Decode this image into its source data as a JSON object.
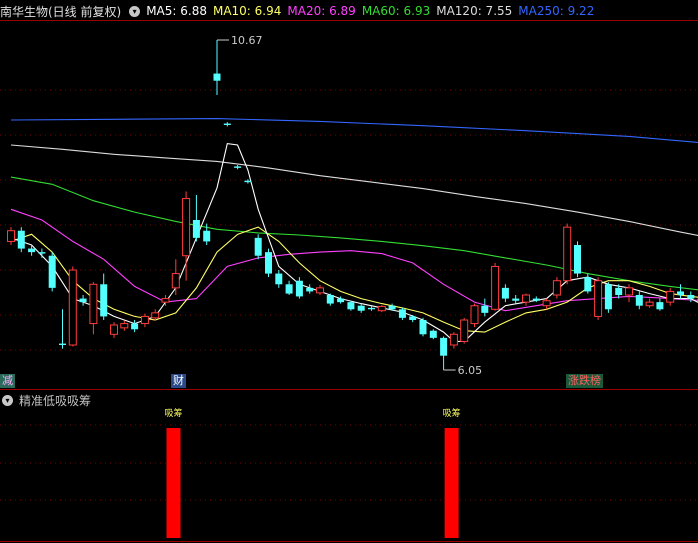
{
  "header": {
    "stock_title": "南华生物(日线 前复权)",
    "ma5": "MA5: 6.88",
    "ma10": "MA10: 6.94",
    "ma20": "MA20: 6.89",
    "ma60": "MA60: 6.93",
    "ma120": "MA120: 7.55",
    "ma250": "MA250: 9.22"
  },
  "subpanel": {
    "title": "精准低吸吸筹",
    "signal_label": "吸筹"
  },
  "markers": {
    "left": "减",
    "middle": "财",
    "right": "涨跌榜"
  },
  "colors": {
    "up": "#ff3c3c",
    "down": "#54ffff",
    "ma5": "#ffffff",
    "ma10": "#ffff66",
    "ma20": "#ff40ff",
    "ma60": "#33dd33",
    "ma120": "#dcdcdc",
    "ma250": "#3366ff",
    "grid": "#7a0000",
    "signal_bar": "#ff0000"
  },
  "chart_data": {
    "type": "candlestick",
    "annotations": {
      "high_label": "10.67",
      "low_label": "6.05"
    },
    "candles": [
      {
        "o": 7.85,
        "c": 8.0,
        "h": 8.05,
        "l": 7.8,
        "up": true
      },
      {
        "o": 8.0,
        "c": 7.75,
        "h": 8.05,
        "l": 7.7,
        "up": false
      },
      {
        "o": 7.75,
        "c": 7.7,
        "h": 7.8,
        "l": 7.65,
        "up": false
      },
      {
        "o": 7.7,
        "c": 7.68,
        "h": 7.75,
        "l": 7.62,
        "up": false
      },
      {
        "o": 7.65,
        "c": 7.2,
        "h": 7.7,
        "l": 7.15,
        "up": false
      },
      {
        "o": 6.42,
        "c": 6.4,
        "h": 6.9,
        "l": 6.35,
        "up": false
      },
      {
        "o": 6.4,
        "c": 7.45,
        "h": 7.5,
        "l": 6.38,
        "up": true
      },
      {
        "o": 7.0,
        "c": 7.05,
        "h": 7.1,
        "l": 6.95,
        "up": false
      },
      {
        "o": 6.7,
        "c": 7.25,
        "h": 7.28,
        "l": 6.55,
        "up": true
      },
      {
        "o": 7.25,
        "c": 6.8,
        "h": 7.4,
        "l": 6.75,
        "up": false
      },
      {
        "o": 6.55,
        "c": 6.68,
        "h": 6.72,
        "l": 6.5,
        "up": true
      },
      {
        "o": 6.64,
        "c": 6.7,
        "h": 6.74,
        "l": 6.6,
        "up": true
      },
      {
        "o": 6.7,
        "c": 6.62,
        "h": 6.75,
        "l": 6.58,
        "up": false
      },
      {
        "o": 6.7,
        "c": 6.8,
        "h": 6.84,
        "l": 6.65,
        "up": true
      },
      {
        "o": 6.78,
        "c": 6.85,
        "h": 6.9,
        "l": 6.74,
        "up": true
      },
      {
        "o": 7.0,
        "c": 7.05,
        "h": 7.1,
        "l": 6.95,
        "up": true
      },
      {
        "o": 7.2,
        "c": 7.4,
        "h": 7.6,
        "l": 7.1,
        "up": true
      },
      {
        "o": 7.65,
        "c": 8.45,
        "h": 8.55,
        "l": 7.3,
        "up": true
      },
      {
        "o": 8.15,
        "c": 7.9,
        "h": 8.5,
        "l": 7.85,
        "up": false
      },
      {
        "o": 8.0,
        "c": 7.85,
        "h": 8.1,
        "l": 7.8,
        "up": false
      },
      {
        "o": 10.1,
        "c": 10.2,
        "h": 10.67,
        "l": 9.9,
        "up": false
      },
      {
        "o": 9.5,
        "c": 9.48,
        "h": 9.52,
        "l": 9.46,
        "up": false
      },
      {
        "o": 8.9,
        "c": 8.88,
        "h": 8.92,
        "l": 8.86,
        "up": false
      },
      {
        "o": 8.7,
        "c": 8.68,
        "h": 8.72,
        "l": 8.66,
        "up": false
      },
      {
        "o": 7.9,
        "c": 7.65,
        "h": 7.95,
        "l": 7.6,
        "up": false
      },
      {
        "o": 7.7,
        "c": 7.4,
        "h": 7.75,
        "l": 7.35,
        "up": false
      },
      {
        "o": 7.4,
        "c": 7.25,
        "h": 7.45,
        "l": 7.2,
        "up": false
      },
      {
        "o": 7.25,
        "c": 7.12,
        "h": 7.3,
        "l": 7.1,
        "up": false
      },
      {
        "o": 7.3,
        "c": 7.08,
        "h": 7.35,
        "l": 7.05,
        "up": false
      },
      {
        "o": 7.2,
        "c": 7.15,
        "h": 7.25,
        "l": 7.12,
        "up": false
      },
      {
        "o": 7.13,
        "c": 7.2,
        "h": 7.24,
        "l": 7.1,
        "up": true
      },
      {
        "o": 7.1,
        "c": 6.98,
        "h": 7.12,
        "l": 6.95,
        "up": false
      },
      {
        "o": 7.05,
        "c": 7.0,
        "h": 7.08,
        "l": 6.98,
        "up": false
      },
      {
        "o": 7.0,
        "c": 6.9,
        "h": 7.02,
        "l": 6.88,
        "up": false
      },
      {
        "o": 6.95,
        "c": 6.88,
        "h": 6.98,
        "l": 6.85,
        "up": false
      },
      {
        "o": 6.92,
        "c": 6.9,
        "h": 6.94,
        "l": 6.88,
        "up": false
      },
      {
        "o": 6.88,
        "c": 6.94,
        "h": 6.96,
        "l": 6.86,
        "up": true
      },
      {
        "o": 6.95,
        "c": 6.9,
        "h": 6.98,
        "l": 6.88,
        "up": false
      },
      {
        "o": 6.9,
        "c": 6.78,
        "h": 6.92,
        "l": 6.75,
        "up": false
      },
      {
        "o": 6.8,
        "c": 6.75,
        "h": 6.82,
        "l": 6.72,
        "up": false
      },
      {
        "o": 6.75,
        "c": 6.55,
        "h": 6.78,
        "l": 6.52,
        "up": false
      },
      {
        "o": 6.6,
        "c": 6.5,
        "h": 6.62,
        "l": 6.48,
        "up": false
      },
      {
        "o": 6.5,
        "c": 6.25,
        "h": 6.52,
        "l": 6.05,
        "up": false
      },
      {
        "o": 6.4,
        "c": 6.55,
        "h": 6.58,
        "l": 6.35,
        "up": true
      },
      {
        "o": 6.45,
        "c": 6.75,
        "h": 6.78,
        "l": 6.42,
        "up": true
      },
      {
        "o": 6.7,
        "c": 6.95,
        "h": 6.98,
        "l": 6.65,
        "up": true
      },
      {
        "o": 6.95,
        "c": 6.85,
        "h": 7.05,
        "l": 6.8,
        "up": false
      },
      {
        "o": 6.9,
        "c": 7.5,
        "h": 7.55,
        "l": 6.88,
        "up": true
      },
      {
        "o": 7.2,
        "c": 7.05,
        "h": 7.25,
        "l": 7.0,
        "up": false
      },
      {
        "o": 7.05,
        "c": 7.02,
        "h": 7.1,
        "l": 6.98,
        "up": false
      },
      {
        "o": 7.0,
        "c": 7.1,
        "h": 7.12,
        "l": 6.95,
        "up": true
      },
      {
        "o": 7.05,
        "c": 7.02,
        "h": 7.08,
        "l": 7.0,
        "up": false
      },
      {
        "o": 6.95,
        "c": 7.02,
        "h": 7.05,
        "l": 6.9,
        "up": true
      },
      {
        "o": 7.1,
        "c": 7.3,
        "h": 7.35,
        "l": 7.05,
        "up": true
      },
      {
        "o": 7.3,
        "c": 8.05,
        "h": 8.1,
        "l": 7.25,
        "up": true
      },
      {
        "o": 7.8,
        "c": 7.4,
        "h": 7.85,
        "l": 7.35,
        "up": false
      },
      {
        "o": 7.35,
        "c": 7.15,
        "h": 7.4,
        "l": 7.12,
        "up": false
      },
      {
        "o": 6.8,
        "c": 7.3,
        "h": 7.35,
        "l": 6.75,
        "up": true
      },
      {
        "o": 7.25,
        "c": 6.9,
        "h": 7.28,
        "l": 6.85,
        "up": false
      },
      {
        "o": 7.2,
        "c": 7.1,
        "h": 7.25,
        "l": 7.05,
        "up": false
      },
      {
        "o": 7.1,
        "c": 7.2,
        "h": 7.25,
        "l": 7.0,
        "up": true
      },
      {
        "o": 7.1,
        "c": 6.95,
        "h": 7.15,
        "l": 6.9,
        "up": false
      },
      {
        "o": 6.95,
        "c": 7.0,
        "h": 7.05,
        "l": 6.92,
        "up": true
      },
      {
        "o": 7.0,
        "c": 6.9,
        "h": 7.05,
        "l": 6.88,
        "up": false
      },
      {
        "o": 7.0,
        "c": 7.15,
        "h": 7.2,
        "l": 6.95,
        "up": true
      },
      {
        "o": 7.15,
        "c": 7.1,
        "h": 7.25,
        "l": 7.05,
        "up": false
      },
      {
        "o": 7.1,
        "c": 7.05,
        "h": 7.15,
        "l": 7.0,
        "up": false
      },
      {
        "o": 7.05,
        "c": 7.0,
        "h": 7.1,
        "l": 6.95,
        "up": false
      },
      {
        "o": 7.0,
        "c": 6.95,
        "h": 7.05,
        "l": 6.6,
        "up": false
      }
    ],
    "ma_lines": [
      {
        "name": "MA250",
        "key": "ma250",
        "points": [
          [
            0,
            9.55
          ],
          [
            10,
            9.56
          ],
          [
            20,
            9.57
          ],
          [
            30,
            9.53
          ],
          [
            40,
            9.47
          ],
          [
            50,
            9.4
          ],
          [
            60,
            9.32
          ],
          [
            68,
            9.22
          ]
        ]
      },
      {
        "name": "MA120",
        "key": "ma120",
        "points": [
          [
            0,
            9.2
          ],
          [
            5,
            9.14
          ],
          [
            10,
            9.07
          ],
          [
            15,
            9.02
          ],
          [
            20,
            8.97
          ],
          [
            25,
            8.88
          ],
          [
            30,
            8.77
          ],
          [
            35,
            8.68
          ],
          [
            40,
            8.59
          ],
          [
            45,
            8.48
          ],
          [
            50,
            8.38
          ],
          [
            55,
            8.26
          ],
          [
            60,
            8.13
          ],
          [
            65,
            7.98
          ],
          [
            68,
            7.9
          ]
        ]
      },
      {
        "name": "MA60",
        "key": "ma60",
        "points": [
          [
            0,
            8.75
          ],
          [
            4,
            8.65
          ],
          [
            8,
            8.42
          ],
          [
            12,
            8.26
          ],
          [
            16,
            8.13
          ],
          [
            20,
            8.02
          ],
          [
            24,
            7.97
          ],
          [
            28,
            7.94
          ],
          [
            32,
            7.9
          ],
          [
            36,
            7.85
          ],
          [
            40,
            7.79
          ],
          [
            44,
            7.72
          ],
          [
            48,
            7.62
          ],
          [
            52,
            7.52
          ],
          [
            56,
            7.4
          ],
          [
            60,
            7.3
          ],
          [
            64,
            7.22
          ],
          [
            68,
            7.15
          ]
        ]
      },
      {
        "name": "MA20",
        "key": "ma20",
        "points": [
          [
            0,
            8.3
          ],
          [
            3,
            8.15
          ],
          [
            6,
            7.85
          ],
          [
            9,
            7.6
          ],
          [
            12,
            7.22
          ],
          [
            15,
            7.0
          ],
          [
            18,
            7.05
          ],
          [
            21,
            7.5
          ],
          [
            24,
            7.62
          ],
          [
            27,
            7.67
          ],
          [
            30,
            7.7
          ],
          [
            33,
            7.72
          ],
          [
            36,
            7.68
          ],
          [
            39,
            7.55
          ],
          [
            42,
            7.25
          ],
          [
            45,
            7.0
          ],
          [
            48,
            6.88
          ],
          [
            51,
            6.95
          ],
          [
            54,
            7.02
          ],
          [
            57,
            7.05
          ],
          [
            60,
            7.08
          ],
          [
            63,
            7.06
          ],
          [
            66,
            7.03
          ],
          [
            68,
            7.02
          ]
        ]
      },
      {
        "name": "MA10",
        "key": "ma10",
        "points": [
          [
            0,
            7.85
          ],
          [
            2,
            7.95
          ],
          [
            4,
            7.7
          ],
          [
            6,
            7.3
          ],
          [
            8,
            7.05
          ],
          [
            10,
            6.9
          ],
          [
            12,
            6.8
          ],
          [
            14,
            6.75
          ],
          [
            16,
            6.85
          ],
          [
            18,
            7.2
          ],
          [
            20,
            7.7
          ],
          [
            22,
            7.95
          ],
          [
            24,
            8.05
          ],
          [
            26,
            7.85
          ],
          [
            28,
            7.55
          ],
          [
            30,
            7.3
          ],
          [
            32,
            7.15
          ],
          [
            34,
            7.05
          ],
          [
            36,
            6.98
          ],
          [
            38,
            6.92
          ],
          [
            40,
            6.85
          ],
          [
            42,
            6.72
          ],
          [
            44,
            6.6
          ],
          [
            46,
            6.58
          ],
          [
            48,
            6.72
          ],
          [
            50,
            6.85
          ],
          [
            52,
            6.9
          ],
          [
            54,
            7.0
          ],
          [
            56,
            7.2
          ],
          [
            58,
            7.3
          ],
          [
            60,
            7.3
          ],
          [
            62,
            7.22
          ],
          [
            64,
            7.12
          ],
          [
            66,
            7.08
          ],
          [
            68,
            7.05
          ]
        ]
      },
      {
        "name": "MA5",
        "key": "ma5",
        "points": [
          [
            0,
            7.9
          ],
          [
            2,
            7.8
          ],
          [
            4,
            7.5
          ],
          [
            6,
            7.05
          ],
          [
            8,
            6.95
          ],
          [
            10,
            6.8
          ],
          [
            12,
            6.7
          ],
          [
            14,
            6.8
          ],
          [
            16,
            7.2
          ],
          [
            18,
            7.9
          ],
          [
            20,
            8.6
          ],
          [
            21,
            9.22
          ],
          [
            22,
            9.2
          ],
          [
            23,
            8.85
          ],
          [
            24,
            8.3
          ],
          [
            25,
            7.9
          ],
          [
            26,
            7.5
          ],
          [
            28,
            7.25
          ],
          [
            30,
            7.15
          ],
          [
            32,
            7.05
          ],
          [
            34,
            6.98
          ],
          [
            36,
            6.92
          ],
          [
            38,
            6.86
          ],
          [
            40,
            6.75
          ],
          [
            42,
            6.58
          ],
          [
            43,
            6.45
          ],
          [
            44,
            6.45
          ],
          [
            46,
            6.72
          ],
          [
            48,
            6.95
          ],
          [
            50,
            7.0
          ],
          [
            52,
            7.05
          ],
          [
            54,
            7.3
          ],
          [
            56,
            7.35
          ],
          [
            58,
            7.25
          ],
          [
            60,
            7.2
          ],
          [
            62,
            7.12
          ],
          [
            64,
            7.05
          ],
          [
            66,
            7.05
          ],
          [
            68,
            6.9
          ]
        ]
      }
    ],
    "signals": [
      {
        "index": 15,
        "value": 1
      },
      {
        "index": 42,
        "value": 1
      }
    ]
  }
}
